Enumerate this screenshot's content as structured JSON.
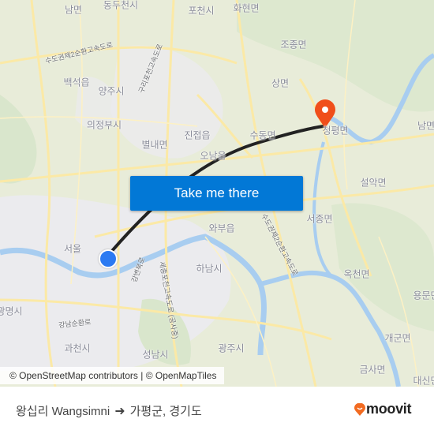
{
  "map": {
    "places": [
      {
        "name": "남면",
        "id": "nammyeon-nw"
      },
      {
        "name": "동두천시",
        "id": "dongducheon"
      },
      {
        "name": "포천시",
        "id": "pocheon"
      },
      {
        "name": "화현면",
        "id": "hwahyeon"
      },
      {
        "name": "조종면",
        "id": "jojong"
      },
      {
        "name": "백석읍",
        "id": "baekseok"
      },
      {
        "name": "양주시",
        "id": "yangju"
      },
      {
        "name": "상면",
        "id": "sangmyeon"
      },
      {
        "name": "의정부시",
        "id": "uijeongbu"
      },
      {
        "name": "진접읍",
        "id": "jinjeop"
      },
      {
        "name": "별내면",
        "id": "byeollae"
      },
      {
        "name": "오남읍",
        "id": "onam"
      },
      {
        "name": "수동면",
        "id": "sudong"
      },
      {
        "name": "청평면",
        "id": "cheongpyeong"
      },
      {
        "name": "남면",
        "id": "nammyeon-e"
      },
      {
        "name": "설악면",
        "id": "seorak"
      },
      {
        "name": "서종면",
        "id": "seojong"
      },
      {
        "name": "와부읍",
        "id": "wabu"
      },
      {
        "name": "서울",
        "id": "seoul"
      },
      {
        "name": "하남시",
        "id": "hanam"
      },
      {
        "name": "옥천면",
        "id": "okcheon"
      },
      {
        "name": "용문면",
        "id": "yongmun"
      },
      {
        "name": "광명시",
        "id": "gwangmyeong"
      },
      {
        "name": "개군면",
        "id": "gaegun"
      },
      {
        "name": "과천시",
        "id": "gwacheon"
      },
      {
        "name": "광주시",
        "id": "gwangju"
      },
      {
        "name": "성남시",
        "id": "seongnam"
      },
      {
        "name": "금사면",
        "id": "geumsa"
      },
      {
        "name": "대신면",
        "id": "daesin"
      }
    ],
    "road_labels": [
      {
        "name": "수도권제2순환고속도로"
      },
      {
        "name": "구리포천고속도로"
      },
      {
        "name": "강남순환로"
      },
      {
        "name": "세종포천고속도로 (공사중)"
      },
      {
        "name": "강변북로"
      },
      {
        "name": "수도권제2순환고속도로"
      }
    ],
    "attribution": "© OpenStreetMap contributors | © OpenMapTiles"
  },
  "cta": {
    "label": "Take me there"
  },
  "route": {
    "origin": "왕십리 Wangsimni",
    "arrow_icon": "arrow-right-icon",
    "destination": "가평군, 경기도"
  },
  "brand": {
    "name": "moovit",
    "color": "#f26b21"
  },
  "colors": {
    "cta": "#0278d6",
    "origin_dot": "#2b7af2",
    "destination_pin": "#f04e1a",
    "route_line": "#222222"
  }
}
